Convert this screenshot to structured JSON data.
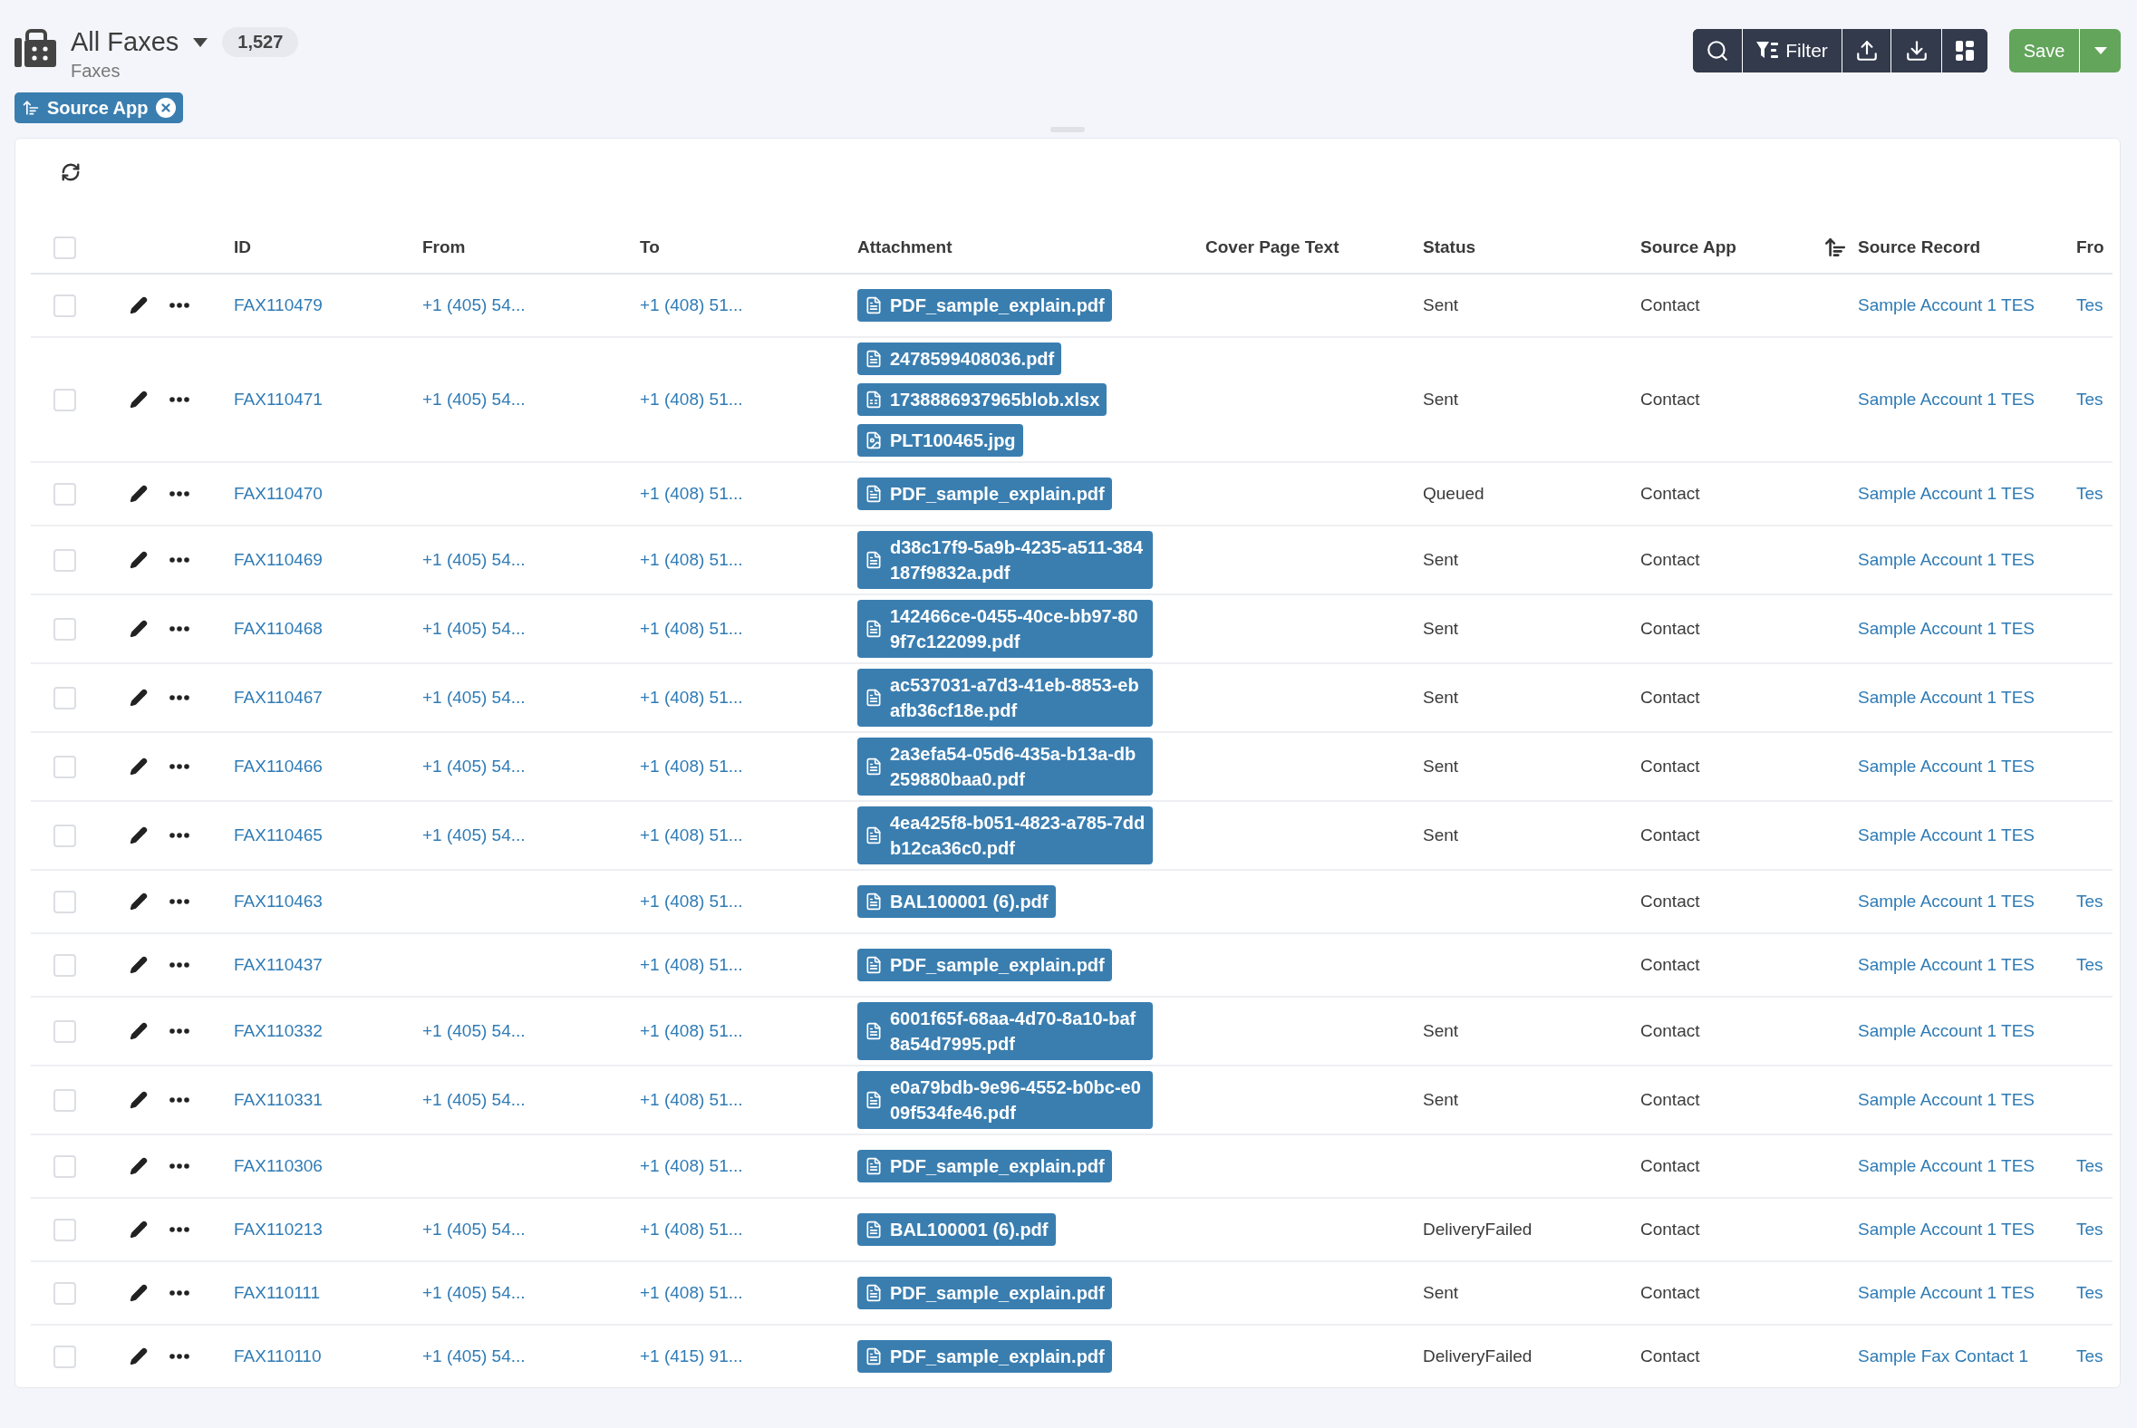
{
  "header": {
    "title": "All Faxes",
    "count": "1,527",
    "subtitle": "Faxes"
  },
  "toolbar": {
    "filter_label": "Filter",
    "save_label": "Save"
  },
  "active_sorts": [
    {
      "label": "Source App"
    }
  ],
  "table": {
    "all_checked": false,
    "columns": [
      {
        "label": "ID",
        "sorted": false
      },
      {
        "label": "From",
        "sorted": false
      },
      {
        "label": "To",
        "sorted": false
      },
      {
        "label": "Attachment",
        "sorted": false
      },
      {
        "label": "Cover Page Text",
        "sorted": false
      },
      {
        "label": "Status",
        "sorted": false
      },
      {
        "label": "Source App",
        "sorted": true
      },
      {
        "label": "Source Record",
        "sorted": false
      },
      {
        "label": "Fro",
        "sorted": false
      }
    ],
    "rows": [
      {
        "checked": false,
        "id": "FAX110479",
        "from": "+1 (405) 54...",
        "to": "+1 (408) 51...",
        "attachments": [
          {
            "kind": "pdf",
            "name": "PDF_sample_explain.pdf"
          }
        ],
        "status": "Sent",
        "source_app": "Contact",
        "source_record": "Sample Account 1 TES",
        "column_11": "Tes"
      },
      {
        "checked": false,
        "id": "FAX110471",
        "from": "+1 (405) 54...",
        "to": "+1 (408) 51...",
        "attachments": [
          {
            "kind": "pdf",
            "name": "2478599408036.pdf"
          },
          {
            "kind": "sheet",
            "name": "1738886937965blob.xlsx"
          },
          {
            "kind": "image",
            "name": "PLT100465.jpg"
          }
        ],
        "status": "Sent",
        "source_app": "Contact",
        "source_record": "Sample Account 1 TES",
        "column_11": "Tes"
      },
      {
        "checked": false,
        "id": "FAX110470",
        "to": "+1 (408) 51...",
        "attachments": [
          {
            "kind": "pdf",
            "name": "PDF_sample_explain.pdf"
          }
        ],
        "status": "Queued",
        "source_app": "Contact",
        "source_record": "Sample Account 1 TES",
        "column_11": "Tes"
      },
      {
        "checked": false,
        "id": "FAX110469",
        "from": "+1 (405) 54...",
        "to": "+1 (408) 51...",
        "attachments": [
          {
            "kind": "pdf",
            "name": "d38c17f9-5a9b-4235-a511-384187f9832a.pdf"
          }
        ],
        "status": "Sent",
        "source_app": "Contact",
        "source_record": "Sample Account 1 TES"
      },
      {
        "checked": false,
        "id": "FAX110468",
        "from": "+1 (405) 54...",
        "to": "+1 (408) 51...",
        "attachments": [
          {
            "kind": "pdf",
            "name": "142466ce-0455-40ce-bb97-809f7c122099.pdf"
          }
        ],
        "status": "Sent",
        "source_app": "Contact",
        "source_record": "Sample Account 1 TES"
      },
      {
        "checked": false,
        "id": "FAX110467",
        "from": "+1 (405) 54...",
        "to": "+1 (408) 51...",
        "attachments": [
          {
            "kind": "pdf",
            "name": "ac537031-a7d3-41eb-8853-ebafb36cf18e.pdf"
          }
        ],
        "status": "Sent",
        "source_app": "Contact",
        "source_record": "Sample Account 1 TES"
      },
      {
        "checked": false,
        "id": "FAX110466",
        "from": "+1 (405) 54...",
        "to": "+1 (408) 51...",
        "attachments": [
          {
            "kind": "pdf",
            "name": "2a3efa54-05d6-435a-b13a-db259880baa0.pdf"
          }
        ],
        "status": "Sent",
        "source_app": "Contact",
        "source_record": "Sample Account 1 TES"
      },
      {
        "checked": false,
        "id": "FAX110465",
        "from": "+1 (405) 54...",
        "to": "+1 (408) 51...",
        "attachments": [
          {
            "kind": "pdf",
            "name": "4ea425f8-b051-4823-a785-7ddb12ca36c0.pdf"
          }
        ],
        "status": "Sent",
        "source_app": "Contact",
        "source_record": "Sample Account 1 TES"
      },
      {
        "checked": false,
        "id": "FAX110463",
        "to": "+1 (408) 51...",
        "attachments": [
          {
            "kind": "pdf",
            "name": "BAL100001 (6).pdf"
          }
        ],
        "source_app": "Contact",
        "source_record": "Sample Account 1 TES",
        "column_11": "Tes"
      },
      {
        "checked": false,
        "id": "FAX110437",
        "to": "+1 (408) 51...",
        "attachments": [
          {
            "kind": "pdf",
            "name": "PDF_sample_explain.pdf"
          }
        ],
        "source_app": "Contact",
        "source_record": "Sample Account 1 TES",
        "column_11": "Tes"
      },
      {
        "checked": false,
        "id": "FAX110332",
        "from": "+1 (405) 54...",
        "to": "+1 (408) 51...",
        "attachments": [
          {
            "kind": "pdf",
            "name": "6001f65f-68aa-4d70-8a10-baf8a54d7995.pdf"
          }
        ],
        "status": "Sent",
        "source_app": "Contact",
        "source_record": "Sample Account 1 TES"
      },
      {
        "checked": false,
        "id": "FAX110331",
        "from": "+1 (405) 54...",
        "to": "+1 (408) 51...",
        "attachments": [
          {
            "kind": "pdf",
            "name": "e0a79bdb-9e96-4552-b0bc-e009f534fe46.pdf"
          }
        ],
        "status": "Sent",
        "source_app": "Contact",
        "source_record": "Sample Account 1 TES"
      },
      {
        "checked": false,
        "id": "FAX110306",
        "to": "+1 (408) 51...",
        "attachments": [
          {
            "kind": "pdf",
            "name": "PDF_sample_explain.pdf"
          }
        ],
        "source_app": "Contact",
        "source_record": "Sample Account 1 TES",
        "column_11": "Tes"
      },
      {
        "checked": false,
        "id": "FAX110213",
        "from": "+1 (405) 54...",
        "to": "+1 (408) 51...",
        "attachments": [
          {
            "kind": "pdf",
            "name": "BAL100001 (6).pdf"
          }
        ],
        "status": "DeliveryFailed",
        "source_app": "Contact",
        "source_record": "Sample Account 1 TES",
        "column_11": "Tes"
      },
      {
        "checked": false,
        "id": "FAX110111",
        "from": "+1 (405) 54...",
        "to": "+1 (408) 51...",
        "attachments": [
          {
            "kind": "pdf",
            "name": "PDF_sample_explain.pdf"
          }
        ],
        "status": "Sent",
        "source_app": "Contact",
        "source_record": "Sample Account 1 TES",
        "column_11": "Tes"
      },
      {
        "checked": false,
        "id": "FAX110110",
        "from": "+1 (405) 54...",
        "to": "+1 (415) 91...",
        "attachments": [
          {
            "kind": "pdf",
            "name": "PDF_sample_explain.pdf"
          }
        ],
        "status": "DeliveryFailed",
        "source_app": "Contact",
        "source_record": "Sample Fax Contact 1",
        "column_11": "Tes"
      }
    ]
  }
}
